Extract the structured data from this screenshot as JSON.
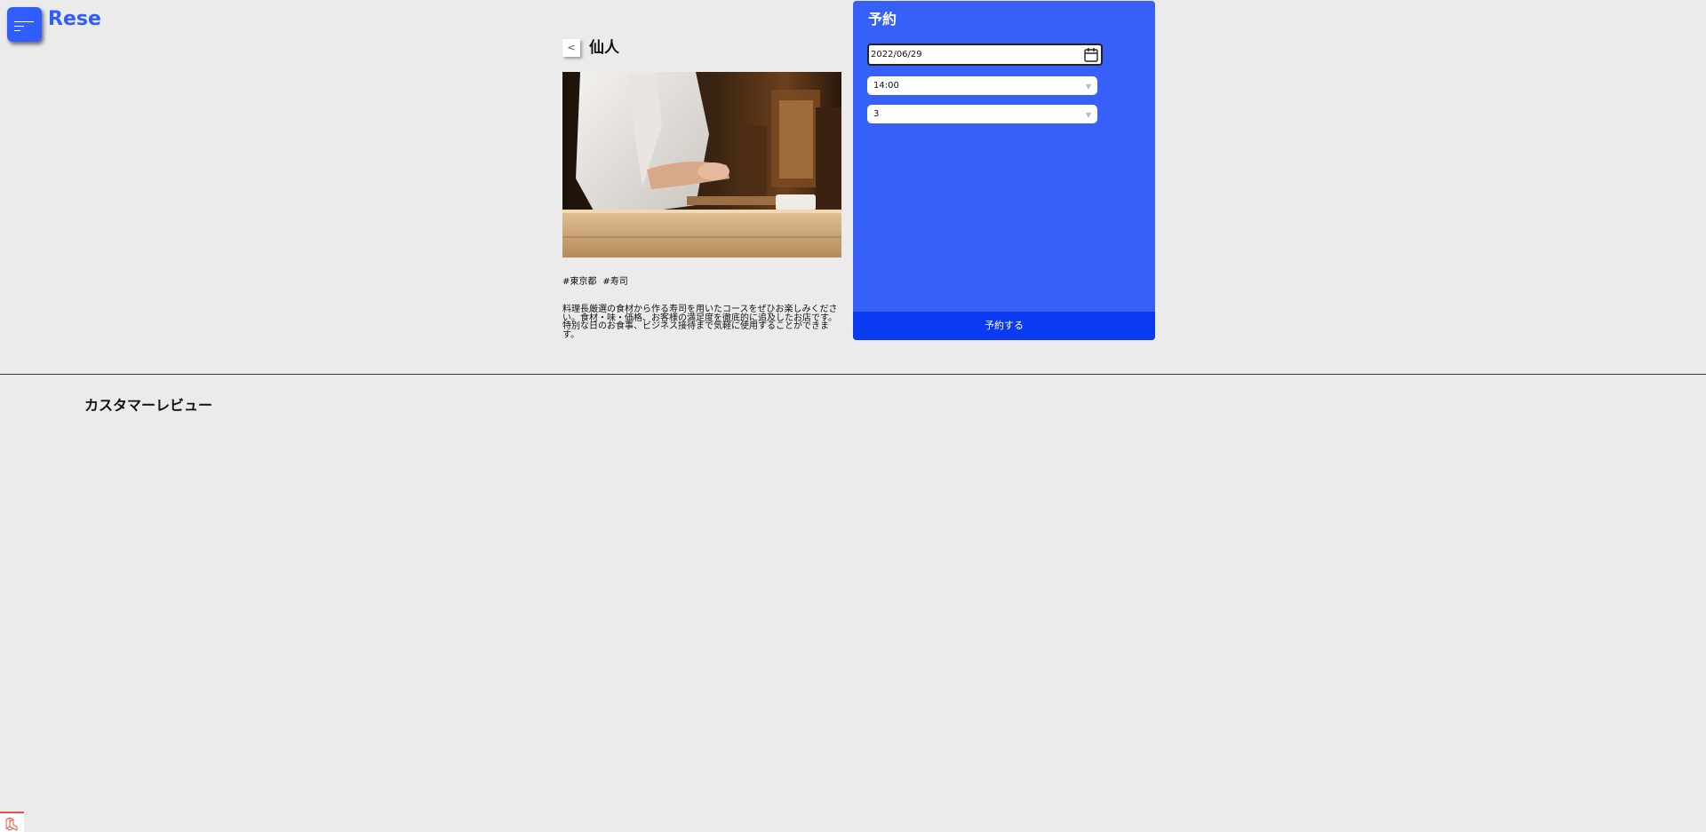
{
  "header": {
    "menu_icon": "hamburger-menu-icon",
    "brand": "Rese",
    "brand_color": "#305DFF"
  },
  "shop": {
    "back_label": "<",
    "name": "仙人",
    "image_alt": "sushi chef",
    "tags": [
      "#東京都",
      "#寿司"
    ],
    "description": "料理長厳選の食材から作る寿司を用いたコースをぜひお楽しみください。食材・味・価格、お客様の満足度を徹底的に追及したお店です。特別な日のお食事、ビジネス接待まで気軽に使用することができます。"
  },
  "reservation": {
    "title": "予約",
    "date_value": "2022/06/29",
    "date_icon": "calendar-icon",
    "time_value": "14:00",
    "number_value": "3",
    "dropdown_icon": "chevron-down-icon",
    "submit_label": "予約する",
    "panel_color": "#3660F7",
    "button_color": "#0A3BF2"
  },
  "reviews": {
    "heading": "カスタマーレビュー"
  },
  "debug": {
    "icon": "laravel-debugbar-icon",
    "accent_color": "#F05340"
  }
}
